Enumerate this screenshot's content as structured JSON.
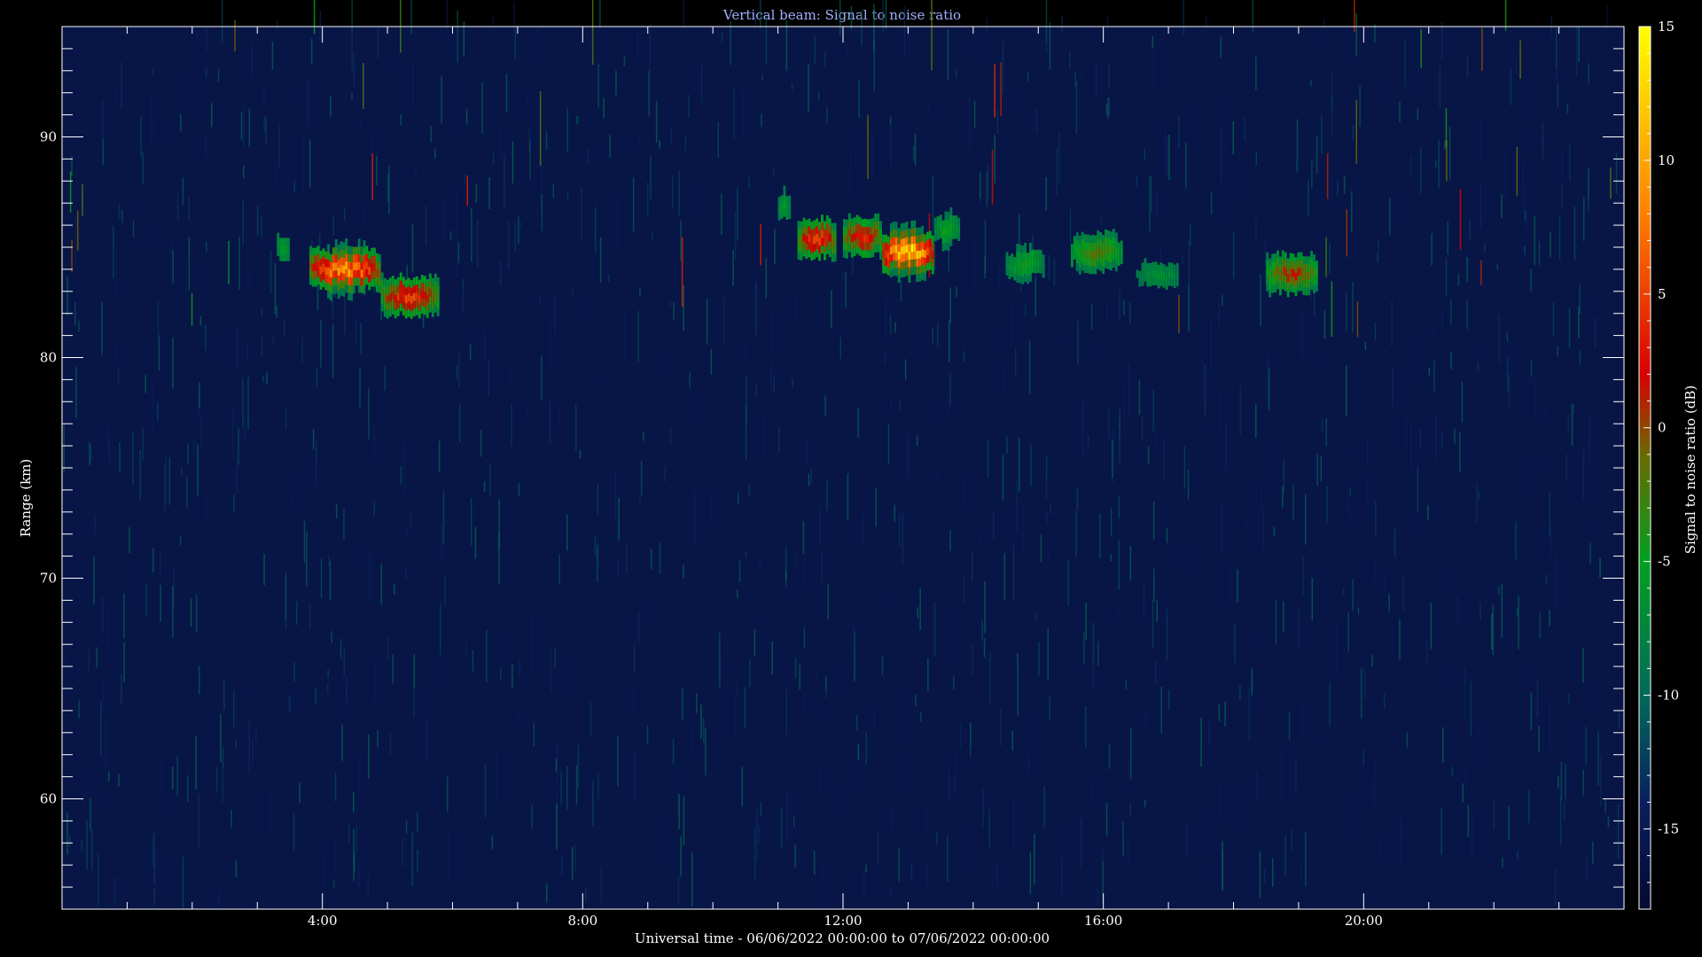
{
  "chart_data": {
    "type": "heatmap",
    "title": "Vertical beam: Signal to noise ratio",
    "xlabel": "Universal time - 06/06/2022 00:00:00 to 07/06/2022 00:00:00",
    "ylabel": "Range (km)",
    "colorbar_label": "Signal to noise ratio (dB)",
    "x_unit": "hours UT",
    "xlim": [
      0,
      24
    ],
    "ylim": [
      55,
      95
    ],
    "clim": [
      -18,
      15
    ],
    "x_ticks": [
      {
        "value": 4,
        "label": "4:00"
      },
      {
        "value": 8,
        "label": "8:00"
      },
      {
        "value": 12,
        "label": "12:00"
      },
      {
        "value": 16,
        "label": "16:00"
      },
      {
        "value": 20,
        "label": "20:00"
      }
    ],
    "y_ticks": [
      {
        "value": 60,
        "label": "60"
      },
      {
        "value": 70,
        "label": "70"
      },
      {
        "value": 80,
        "label": "80"
      },
      {
        "value": 90,
        "label": "90"
      }
    ],
    "colorbar_ticks": [
      {
        "value": 15,
        "label": "15"
      },
      {
        "value": 10,
        "label": "10"
      },
      {
        "value": 5,
        "label": "5"
      },
      {
        "value": 0,
        "label": "0"
      },
      {
        "value": -5,
        "label": "-5"
      },
      {
        "value": -10,
        "label": "-10"
      },
      {
        "value": -15,
        "label": "-15"
      }
    ],
    "colormap": [
      {
        "value": -18,
        "color": "#050a30"
      },
      {
        "value": -14,
        "color": "#0a1f5e"
      },
      {
        "value": -10,
        "color": "#006a5a"
      },
      {
        "value": -5,
        "color": "#00a020"
      },
      {
        "value": -1,
        "color": "#6a6a00"
      },
      {
        "value": 2,
        "color": "#d80000"
      },
      {
        "value": 8,
        "color": "#ff8000"
      },
      {
        "value": 15,
        "color": "#ffff00"
      }
    ],
    "background_snr_db": -16,
    "echo_regions": [
      {
        "t_start": 3.3,
        "t_end": 3.5,
        "range_center": 85.0,
        "peak_snr": -5
      },
      {
        "t_start": 3.8,
        "t_end": 4.9,
        "range_center": 84.0,
        "peak_snr": 11
      },
      {
        "t_start": 4.9,
        "t_end": 5.8,
        "range_center": 82.8,
        "peak_snr": 6
      },
      {
        "t_start": 11.0,
        "t_end": 11.2,
        "range_center": 86.8,
        "peak_snr": -5
      },
      {
        "t_start": 11.3,
        "t_end": 11.9,
        "range_center": 85.4,
        "peak_snr": 6
      },
      {
        "t_start": 12.0,
        "t_end": 12.6,
        "range_center": 85.5,
        "peak_snr": 5
      },
      {
        "t_start": 12.6,
        "t_end": 13.4,
        "range_center": 84.8,
        "peak_snr": 15
      },
      {
        "t_start": 13.4,
        "t_end": 13.8,
        "range_center": 85.8,
        "peak_snr": -4
      },
      {
        "t_start": 14.5,
        "t_end": 15.1,
        "range_center": 84.2,
        "peak_snr": -4
      },
      {
        "t_start": 15.5,
        "t_end": 16.3,
        "range_center": 84.8,
        "peak_snr": -1
      },
      {
        "t_start": 16.5,
        "t_end": 17.2,
        "range_center": 83.8,
        "peak_snr": -6
      },
      {
        "t_start": 18.5,
        "t_end": 19.3,
        "range_center": 83.8,
        "peak_snr": 2
      }
    ]
  }
}
